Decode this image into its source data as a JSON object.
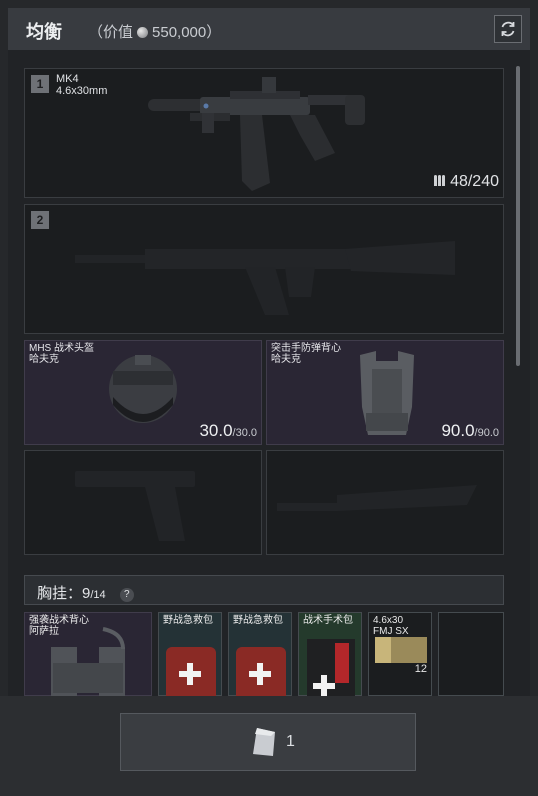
{
  "header": {
    "title": "均衡",
    "value_prefix": "（价值",
    "value_amount": "550,000）"
  },
  "weapons": [
    {
      "slot": "1",
      "name": "MK4",
      "caliber": "4.6x30mm",
      "ammo": "48/240"
    },
    {
      "slot": "2"
    }
  ],
  "armor": [
    {
      "name_line1": "MHS 战术头盔",
      "name_line2": "哈夫克",
      "durability": "30.0",
      "durability_max": "/30.0"
    },
    {
      "name_line1": "突击手防弹背心",
      "name_line2": "哈夫克",
      "durability": "90.0",
      "durability_max": "/90.0"
    }
  ],
  "rig": {
    "label": "胸挂：",
    "used": "9",
    "capacity": "/14",
    "help": "?"
  },
  "items": [
    {
      "line1": "强袭战术背心",
      "line2": "阿萨拉"
    },
    {
      "line1": "野战急救包"
    },
    {
      "line1": "野战急救包"
    },
    {
      "line1": "战术手术包"
    },
    {
      "line1": "4.6x30",
      "line2": "FMJ SX",
      "count": "12"
    }
  ],
  "pocket": {
    "count": "1"
  },
  "colors": {
    "rarity_purple": "#2a2634",
    "rarity_teal": "#243236",
    "rarity_green": "#243a2c"
  }
}
